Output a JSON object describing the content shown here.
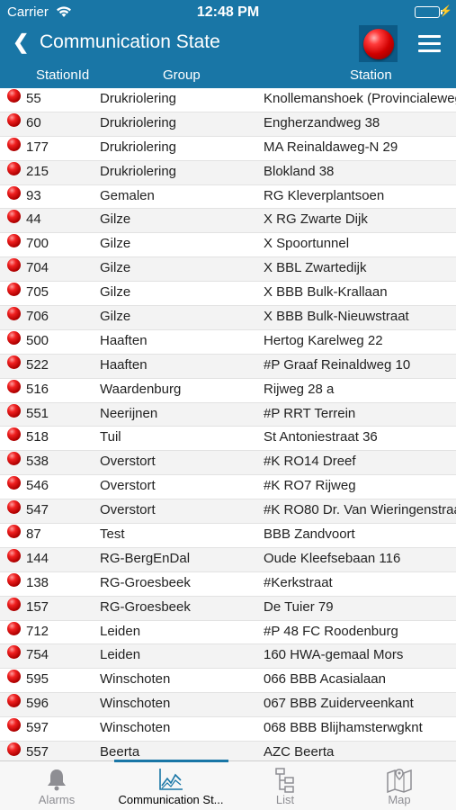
{
  "status": {
    "carrier": "Carrier",
    "time": "12:48 PM"
  },
  "nav": {
    "back_symbol": "❮",
    "title": "Communication State"
  },
  "columns": {
    "id": "StationId",
    "group": "Group",
    "station": "Station"
  },
  "rows": [
    {
      "id": "55",
      "group": "Drukriolering",
      "station": "Knollemanshoek (Provincialeweg"
    },
    {
      "id": "60",
      "group": "Drukriolering",
      "station": "Engherzandweg 38"
    },
    {
      "id": "177",
      "group": "Drukriolering",
      "station": "MA Reinaldaweg-N 29"
    },
    {
      "id": "215",
      "group": "Drukriolering",
      "station": "Blokland 38"
    },
    {
      "id": "93",
      "group": "Gemalen",
      "station": "RG Kleverplantsoen"
    },
    {
      "id": "44",
      "group": "Gilze",
      "station": "X RG Zwarte Dijk"
    },
    {
      "id": "700",
      "group": "Gilze",
      "station": "X Spoortunnel"
    },
    {
      "id": "704",
      "group": "Gilze",
      "station": "X BBL Zwartedijk"
    },
    {
      "id": "705",
      "group": "Gilze",
      "station": "X BBB Bulk-Krallaan"
    },
    {
      "id": "706",
      "group": "Gilze",
      "station": "X BBB Bulk-Nieuwstraat"
    },
    {
      "id": "500",
      "group": "Haaften",
      "station": "Hertog Karelweg 22"
    },
    {
      "id": "522",
      "group": "Haaften",
      "station": "#P Graaf Reinaldweg 10"
    },
    {
      "id": "516",
      "group": "Waardenburg",
      "station": "Rijweg 28 a"
    },
    {
      "id": "551",
      "group": "Neerijnen",
      "station": "#P RRT Terrein"
    },
    {
      "id": "518",
      "group": "Tuil",
      "station": "St Antoniestraat 36"
    },
    {
      "id": "538",
      "group": "Overstort",
      "station": "#K RO14 Dreef"
    },
    {
      "id": "546",
      "group": "Overstort",
      "station": "#K RO7 Rijweg"
    },
    {
      "id": "547",
      "group": "Overstort",
      "station": "#K RO80 Dr. Van Wieringenstraa"
    },
    {
      "id": "87",
      "group": "Test",
      "station": "BBB Zandvoort"
    },
    {
      "id": "144",
      "group": "RG-BergEnDal",
      "station": "Oude Kleefsebaan 116"
    },
    {
      "id": "138",
      "group": "RG-Groesbeek",
      "station": "#Kerkstraat"
    },
    {
      "id": "157",
      "group": "RG-Groesbeek",
      "station": "De Tuier 79"
    },
    {
      "id": "712",
      "group": "Leiden",
      "station": "#P 48 FC Roodenburg"
    },
    {
      "id": "754",
      "group": "Leiden",
      "station": "160 HWA-gemaal Mors"
    },
    {
      "id": "595",
      "group": "Winschoten",
      "station": "066 BBB Acasialaan"
    },
    {
      "id": "596",
      "group": "Winschoten",
      "station": "067 BBB Zuiderveenkant"
    },
    {
      "id": "597",
      "group": "Winschoten",
      "station": "068 BBB Blijhamsterwgknt"
    },
    {
      "id": "557",
      "group": "Beerta",
      "station": "AZC Beerta"
    }
  ],
  "tabs": [
    {
      "label": "Alarms",
      "icon": "bell-icon"
    },
    {
      "label": "Communication St...",
      "icon": "chart-icon",
      "active": true
    },
    {
      "label": "List",
      "icon": "list-tree-icon"
    },
    {
      "label": "Map",
      "icon": "map-icon"
    }
  ],
  "colors": {
    "primary": "#1976a6",
    "alarm_red": "#d00000"
  }
}
